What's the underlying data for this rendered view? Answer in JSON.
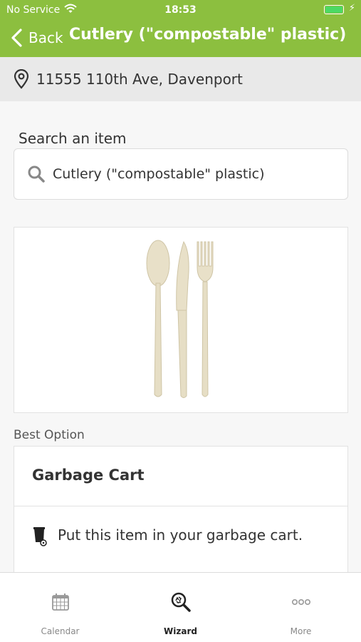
{
  "status_bar": {
    "carrier": "No Service",
    "time": "18:53",
    "battery_level": 1.0,
    "wifi_icon": "wifi-icon",
    "battery_icon": "battery-icon"
  },
  "navbar": {
    "back_label": "Back",
    "title": "Cutlery (\"compostable\" plastic)",
    "background_color": "#8cbf3f"
  },
  "address": {
    "icon": "location-pin-icon",
    "text": "11555 110th Ave, Davenport"
  },
  "search": {
    "label": "Search an item",
    "value": "Cutlery (\"compostable\" plastic)",
    "icon": "search-icon"
  },
  "item_image": {
    "subject": "spoon, knife and fork"
  },
  "best_option": {
    "section_label": "Best Option",
    "title": "Garbage Cart",
    "instruction": "Put this item in your garbage cart.",
    "icon": "garbage-cart-icon"
  },
  "tabs": [
    {
      "label": "Calendar",
      "icon": "calendar-icon",
      "active": false
    },
    {
      "label": "Wizard",
      "icon": "wizard-search-icon",
      "active": true
    },
    {
      "label": "More",
      "icon": "more-icon",
      "active": false
    }
  ]
}
